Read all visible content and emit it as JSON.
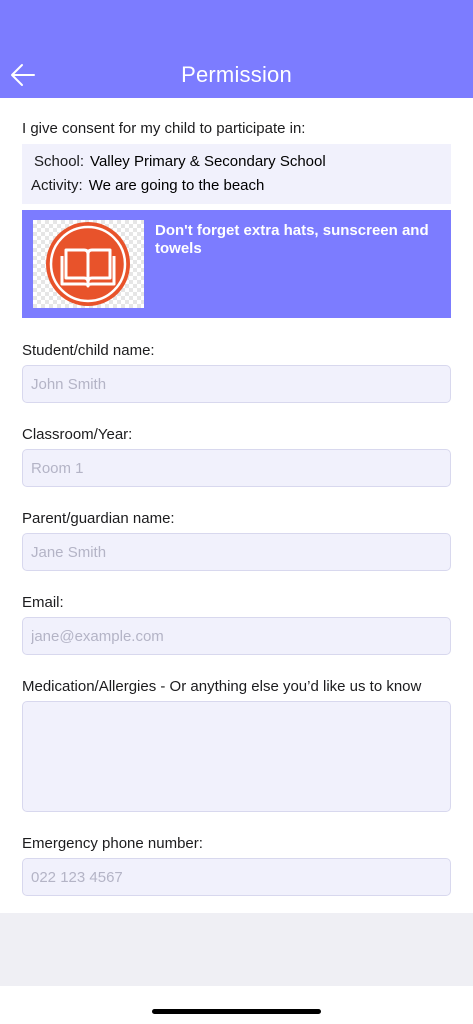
{
  "header": {
    "title": "Permission",
    "back_icon": "arrow-left-icon"
  },
  "consent": {
    "intro": "I give consent for my child to participate in:"
  },
  "info": {
    "school_label": "School:",
    "school_value": "Valley Primary & Secondary School",
    "activity_label": "Activity:",
    "activity_value": "We are going to the beach"
  },
  "banner": {
    "text": "Don't forget extra hats, sunscreen and towels",
    "icon": "book-icon"
  },
  "form": {
    "student": {
      "label": "Student/child name:",
      "placeholder": "John Smith"
    },
    "classroom": {
      "label": "Classroom/Year:",
      "placeholder": "Room 1"
    },
    "parent": {
      "label": "Parent/guardian name:",
      "placeholder": "Jane Smith"
    },
    "email": {
      "label": "Email:",
      "placeholder": "jane@example.com"
    },
    "medication": {
      "label": "Medication/Allergies - Or anything else you’d like us to know"
    },
    "phone": {
      "label": "Emergency phone number:",
      "placeholder": "022 123 4567"
    }
  },
  "colors": {
    "accent": "#7c7cff",
    "field_bg": "#f1f1fc",
    "badge": "#e8532b"
  }
}
